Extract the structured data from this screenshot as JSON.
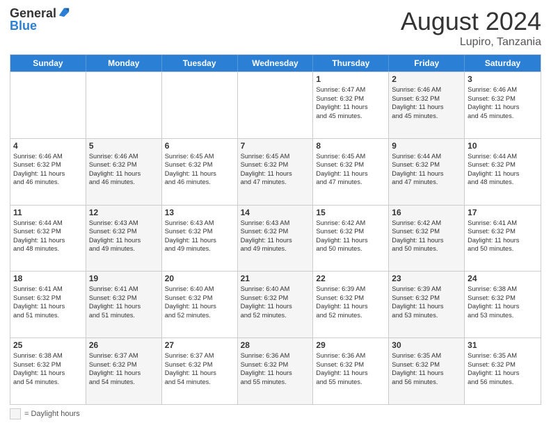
{
  "logo": {
    "general": "General",
    "blue": "Blue"
  },
  "title": "August 2024",
  "location": "Lupiro, Tanzania",
  "header_days": [
    "Sunday",
    "Monday",
    "Tuesday",
    "Wednesday",
    "Thursday",
    "Friday",
    "Saturday"
  ],
  "weeks": [
    [
      {
        "day": "",
        "lines": [],
        "shaded": false
      },
      {
        "day": "",
        "lines": [],
        "shaded": false
      },
      {
        "day": "",
        "lines": [],
        "shaded": false
      },
      {
        "day": "",
        "lines": [],
        "shaded": false
      },
      {
        "day": "1",
        "lines": [
          "Sunrise: 6:47 AM",
          "Sunset: 6:32 PM",
          "Daylight: 11 hours",
          "and 45 minutes."
        ],
        "shaded": false
      },
      {
        "day": "2",
        "lines": [
          "Sunrise: 6:46 AM",
          "Sunset: 6:32 PM",
          "Daylight: 11 hours",
          "and 45 minutes."
        ],
        "shaded": true
      },
      {
        "day": "3",
        "lines": [
          "Sunrise: 6:46 AM",
          "Sunset: 6:32 PM",
          "Daylight: 11 hours",
          "and 45 minutes."
        ],
        "shaded": false
      }
    ],
    [
      {
        "day": "4",
        "lines": [
          "Sunrise: 6:46 AM",
          "Sunset: 6:32 PM",
          "Daylight: 11 hours",
          "and 46 minutes."
        ],
        "shaded": false
      },
      {
        "day": "5",
        "lines": [
          "Sunrise: 6:46 AM",
          "Sunset: 6:32 PM",
          "Daylight: 11 hours",
          "and 46 minutes."
        ],
        "shaded": true
      },
      {
        "day": "6",
        "lines": [
          "Sunrise: 6:45 AM",
          "Sunset: 6:32 PM",
          "Daylight: 11 hours",
          "and 46 minutes."
        ],
        "shaded": false
      },
      {
        "day": "7",
        "lines": [
          "Sunrise: 6:45 AM",
          "Sunset: 6:32 PM",
          "Daylight: 11 hours",
          "and 47 minutes."
        ],
        "shaded": true
      },
      {
        "day": "8",
        "lines": [
          "Sunrise: 6:45 AM",
          "Sunset: 6:32 PM",
          "Daylight: 11 hours",
          "and 47 minutes."
        ],
        "shaded": false
      },
      {
        "day": "9",
        "lines": [
          "Sunrise: 6:44 AM",
          "Sunset: 6:32 PM",
          "Daylight: 11 hours",
          "and 47 minutes."
        ],
        "shaded": true
      },
      {
        "day": "10",
        "lines": [
          "Sunrise: 6:44 AM",
          "Sunset: 6:32 PM",
          "Daylight: 11 hours",
          "and 48 minutes."
        ],
        "shaded": false
      }
    ],
    [
      {
        "day": "11",
        "lines": [
          "Sunrise: 6:44 AM",
          "Sunset: 6:32 PM",
          "Daylight: 11 hours",
          "and 48 minutes."
        ],
        "shaded": false
      },
      {
        "day": "12",
        "lines": [
          "Sunrise: 6:43 AM",
          "Sunset: 6:32 PM",
          "Daylight: 11 hours",
          "and 49 minutes."
        ],
        "shaded": true
      },
      {
        "day": "13",
        "lines": [
          "Sunrise: 6:43 AM",
          "Sunset: 6:32 PM",
          "Daylight: 11 hours",
          "and 49 minutes."
        ],
        "shaded": false
      },
      {
        "day": "14",
        "lines": [
          "Sunrise: 6:43 AM",
          "Sunset: 6:32 PM",
          "Daylight: 11 hours",
          "and 49 minutes."
        ],
        "shaded": true
      },
      {
        "day": "15",
        "lines": [
          "Sunrise: 6:42 AM",
          "Sunset: 6:32 PM",
          "Daylight: 11 hours",
          "and 50 minutes."
        ],
        "shaded": false
      },
      {
        "day": "16",
        "lines": [
          "Sunrise: 6:42 AM",
          "Sunset: 6:32 PM",
          "Daylight: 11 hours",
          "and 50 minutes."
        ],
        "shaded": true
      },
      {
        "day": "17",
        "lines": [
          "Sunrise: 6:41 AM",
          "Sunset: 6:32 PM",
          "Daylight: 11 hours",
          "and 50 minutes."
        ],
        "shaded": false
      }
    ],
    [
      {
        "day": "18",
        "lines": [
          "Sunrise: 6:41 AM",
          "Sunset: 6:32 PM",
          "Daylight: 11 hours",
          "and 51 minutes."
        ],
        "shaded": false
      },
      {
        "day": "19",
        "lines": [
          "Sunrise: 6:41 AM",
          "Sunset: 6:32 PM",
          "Daylight: 11 hours",
          "and 51 minutes."
        ],
        "shaded": true
      },
      {
        "day": "20",
        "lines": [
          "Sunrise: 6:40 AM",
          "Sunset: 6:32 PM",
          "Daylight: 11 hours",
          "and 52 minutes."
        ],
        "shaded": false
      },
      {
        "day": "21",
        "lines": [
          "Sunrise: 6:40 AM",
          "Sunset: 6:32 PM",
          "Daylight: 11 hours",
          "and 52 minutes."
        ],
        "shaded": true
      },
      {
        "day": "22",
        "lines": [
          "Sunrise: 6:39 AM",
          "Sunset: 6:32 PM",
          "Daylight: 11 hours",
          "and 52 minutes."
        ],
        "shaded": false
      },
      {
        "day": "23",
        "lines": [
          "Sunrise: 6:39 AM",
          "Sunset: 6:32 PM",
          "Daylight: 11 hours",
          "and 53 minutes."
        ],
        "shaded": true
      },
      {
        "day": "24",
        "lines": [
          "Sunrise: 6:38 AM",
          "Sunset: 6:32 PM",
          "Daylight: 11 hours",
          "and 53 minutes."
        ],
        "shaded": false
      }
    ],
    [
      {
        "day": "25",
        "lines": [
          "Sunrise: 6:38 AM",
          "Sunset: 6:32 PM",
          "Daylight: 11 hours",
          "and 54 minutes."
        ],
        "shaded": false
      },
      {
        "day": "26",
        "lines": [
          "Sunrise: 6:37 AM",
          "Sunset: 6:32 PM",
          "Daylight: 11 hours",
          "and 54 minutes."
        ],
        "shaded": true
      },
      {
        "day": "27",
        "lines": [
          "Sunrise: 6:37 AM",
          "Sunset: 6:32 PM",
          "Daylight: 11 hours",
          "and 54 minutes."
        ],
        "shaded": false
      },
      {
        "day": "28",
        "lines": [
          "Sunrise: 6:36 AM",
          "Sunset: 6:32 PM",
          "Daylight: 11 hours",
          "and 55 minutes."
        ],
        "shaded": true
      },
      {
        "day": "29",
        "lines": [
          "Sunrise: 6:36 AM",
          "Sunset: 6:32 PM",
          "Daylight: 11 hours",
          "and 55 minutes."
        ],
        "shaded": false
      },
      {
        "day": "30",
        "lines": [
          "Sunrise: 6:35 AM",
          "Sunset: 6:32 PM",
          "Daylight: 11 hours",
          "and 56 minutes."
        ],
        "shaded": true
      },
      {
        "day": "31",
        "lines": [
          "Sunrise: 6:35 AM",
          "Sunset: 6:32 PM",
          "Daylight: 11 hours",
          "and 56 minutes."
        ],
        "shaded": false
      }
    ]
  ],
  "legend": {
    "box_label": "= Daylight hours"
  }
}
